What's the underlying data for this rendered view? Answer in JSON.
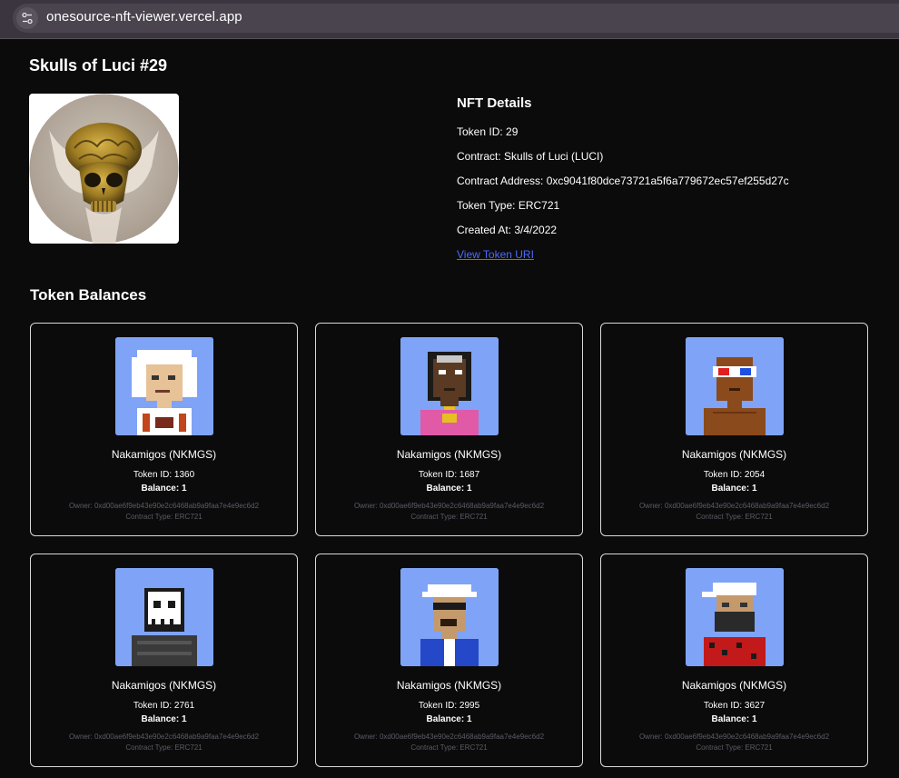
{
  "browser": {
    "url": "onesource-nft-viewer.vercel.app"
  },
  "nft": {
    "title": "Skulls of Luci #29",
    "image_alt": "golden skull held by hands"
  },
  "details": {
    "heading": "NFT Details",
    "token_id": "Token ID: 29",
    "contract": "Contract: Skulls of Luci (LUCI)",
    "contract_address": "Contract Address: 0xc9041f80dce73721a5f6a779672ec57ef255d27c",
    "token_type": "Token Type: ERC721",
    "created_at": "Created At: 3/4/2022",
    "link_label": "View Token URI"
  },
  "balances": {
    "heading": "Token Balances",
    "cards": [
      {
        "name": "Nakamigos (NKMGS)",
        "token": "Token ID: 1360",
        "balance": "Balance: 1",
        "owner": "Owner: 0xd00ae6f9eb43e90e2c6468ab9a9faa7e4e9ec6d2",
        "contract_type": "Contract Type: ERC721"
      },
      {
        "name": "Nakamigos (NKMGS)",
        "token": "Token ID: 1687",
        "balance": "Balance: 1",
        "owner": "Owner: 0xd00ae6f9eb43e90e2c6468ab9a9faa7e4e9ec6d2",
        "contract_type": "Contract Type: ERC721"
      },
      {
        "name": "Nakamigos (NKMGS)",
        "token": "Token ID: 2054",
        "balance": "Balance: 1",
        "owner": "Owner: 0xd00ae6f9eb43e90e2c6468ab9a9faa7e4e9ec6d2",
        "contract_type": "Contract Type: ERC721"
      },
      {
        "name": "Nakamigos (NKMGS)",
        "token": "Token ID: 2761",
        "balance": "Balance: 1",
        "owner": "Owner: 0xd00ae6f9eb43e90e2c6468ab9a9faa7e4e9ec6d2",
        "contract_type": "Contract Type: ERC721"
      },
      {
        "name": "Nakamigos (NKMGS)",
        "token": "Token ID: 2995",
        "balance": "Balance: 1",
        "owner": "Owner: 0xd00ae6f9eb43e90e2c6468ab9a9faa7e4e9ec6d2",
        "contract_type": "Contract Type: ERC721"
      },
      {
        "name": "Nakamigos (NKMGS)",
        "token": "Token ID: 3627",
        "balance": "Balance: 1",
        "owner": "Owner: 0xd00ae6f9eb43e90e2c6468ab9a9faa7e4e9ec6d2",
        "contract_type": "Contract Type: ERC721"
      }
    ]
  },
  "colors": {
    "page_bg": "#0b0b0c",
    "card_border": "#d9d9d9",
    "link": "#4d6bff",
    "avatar_bg": "#7fa3f6"
  }
}
